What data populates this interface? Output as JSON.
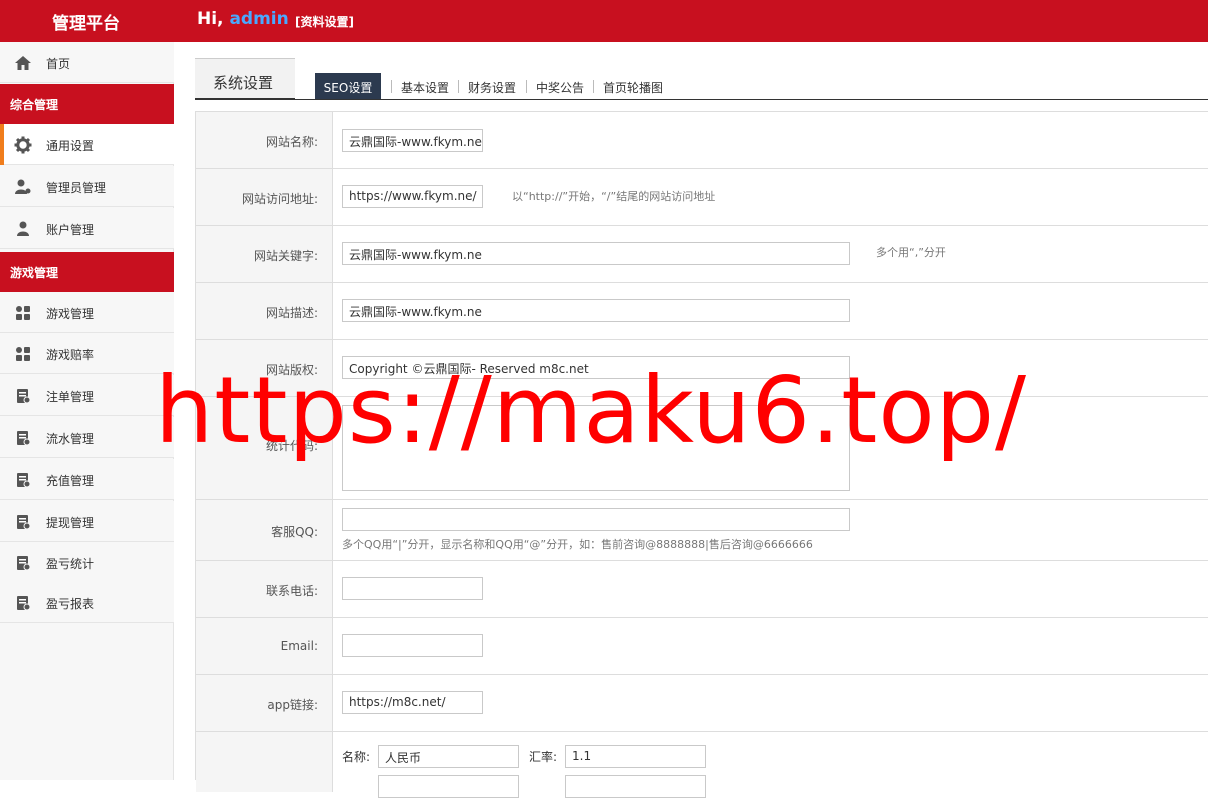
{
  "header": {
    "brand": "管理平台",
    "greeting": "Hi,",
    "username": "admin",
    "profile_link": "[资料设置]"
  },
  "sidebar": {
    "home": "首页",
    "group1": "综合管理",
    "group1_items": [
      {
        "label": "通用设置",
        "icon": "gear-icon"
      },
      {
        "label": "管理员管理",
        "icon": "admin-users-icon"
      },
      {
        "label": "账户管理",
        "icon": "user-icon"
      }
    ],
    "group2": "游戏管理",
    "group2_items": [
      {
        "label": "游戏管理",
        "icon": "game-grid-icon"
      },
      {
        "label": "游戏赔率",
        "icon": "game-grid-icon"
      },
      {
        "label": "注单管理",
        "icon": "document-icon"
      },
      {
        "label": "流水管理",
        "icon": "document-icon"
      },
      {
        "label": "充值管理",
        "icon": "document-icon"
      },
      {
        "label": "提现管理",
        "icon": "document-icon"
      },
      {
        "label": "盈亏统计",
        "icon": "document-icon"
      },
      {
        "label": "盈亏报表",
        "icon": "document-icon"
      }
    ]
  },
  "tabs": {
    "main": "系统设置",
    "sub": [
      "SEO设置",
      "基本设置",
      "财务设置",
      "中奖公告",
      "首页轮播图"
    ]
  },
  "form": {
    "site_name_label": "网站名称:",
    "site_name_value": "云鼎国际-www.fkym.ne",
    "site_url_label": "网站访问地址:",
    "site_url_value": "https://www.fkym.ne/",
    "site_url_hint": "以“http://”开始，“/”结尾的网站访问地址",
    "keywords_label": "网站关键字:",
    "keywords_value": "云鼎国际-www.fkym.ne",
    "keywords_hint": "多个用“,”分开",
    "desc_label": "网站描述:",
    "desc_value": "云鼎国际-www.fkym.ne",
    "copyright_label": "网站版权:",
    "copyright_value": "Copyright ©云鼎国际- Reserved m8c.net",
    "stats_label": "统计代码:",
    "qq_label": "客服QQ:",
    "qq_value": "",
    "qq_hint": "多个QQ用“|”分开，显示名称和QQ用“@”分开，如：售前咨询@8888888|售后咨询@6666666",
    "phone_label": "联系电话:",
    "phone_value": "",
    "email_label": "Email:",
    "email_value": "",
    "app_label": "app链接:",
    "app_value": "https://m8c.net/",
    "currency_name_label": "名称:",
    "currency_name_value": "人民币",
    "rate_label": "汇率:",
    "rate_value": "1.1"
  },
  "watermark": "https://maku6.top/"
}
